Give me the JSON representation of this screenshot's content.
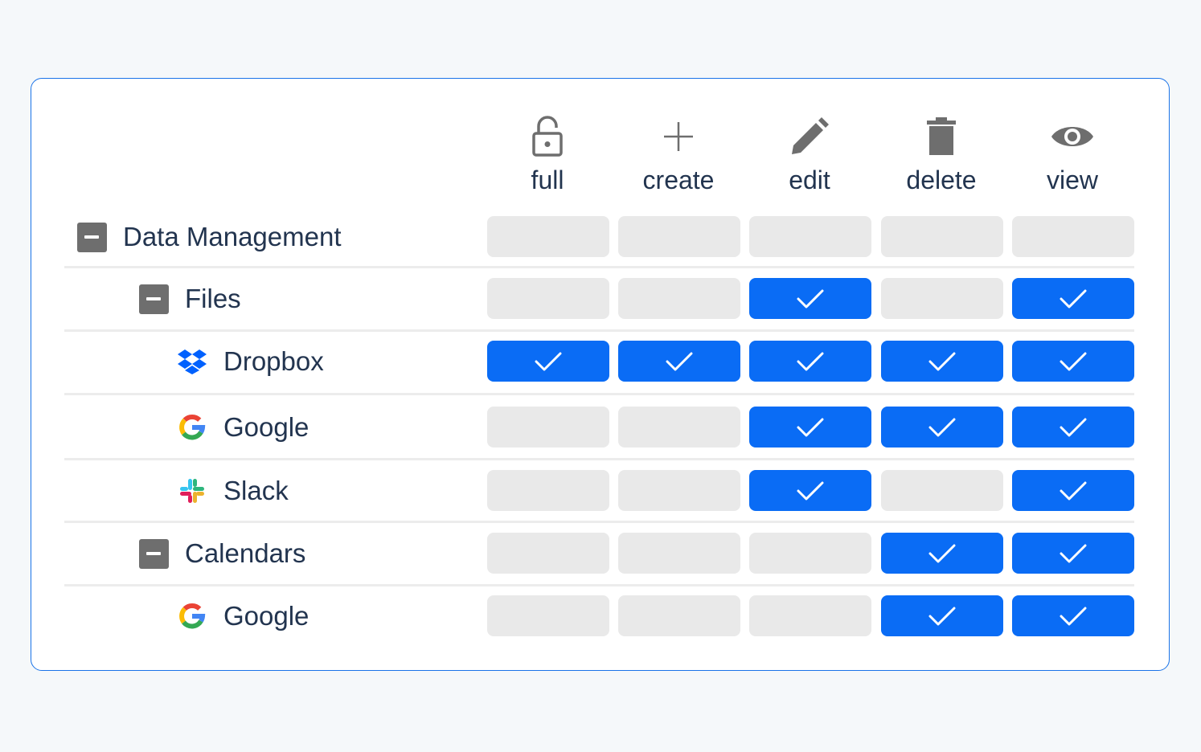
{
  "colors": {
    "accent": "#0a6cf5",
    "off": "#e9e9e9",
    "border": "#1a73e8",
    "text": "#22344f",
    "toggle": "#6e6e6e"
  },
  "columns": [
    {
      "label": "full",
      "icon": "unlock-icon"
    },
    {
      "label": "create",
      "icon": "plus-icon"
    },
    {
      "label": "edit",
      "icon": "pencil-icon"
    },
    {
      "label": "delete",
      "icon": "trash-icon"
    },
    {
      "label": "view",
      "icon": "eye-icon"
    }
  ],
  "rows": [
    {
      "label": "Data Management",
      "icon": "collapse-icon",
      "level": 0,
      "perms": [
        false,
        false,
        false,
        false,
        false
      ]
    },
    {
      "label": "Files",
      "icon": "collapse-icon",
      "level": 1,
      "perms": [
        false,
        false,
        true,
        false,
        true
      ]
    },
    {
      "label": "Dropbox",
      "icon": "dropbox-icon",
      "level": 2,
      "perms": [
        true,
        true,
        true,
        true,
        true
      ]
    },
    {
      "label": "Google",
      "icon": "google-icon",
      "level": 2,
      "perms": [
        false,
        false,
        true,
        true,
        true
      ]
    },
    {
      "label": "Slack",
      "icon": "slack-icon",
      "level": 2,
      "perms": [
        false,
        false,
        true,
        false,
        true
      ]
    },
    {
      "label": "Calendars",
      "icon": "collapse-icon",
      "level": 1,
      "perms": [
        false,
        false,
        false,
        true,
        true
      ]
    },
    {
      "label": "Google",
      "icon": "google-icon",
      "level": 2,
      "perms": [
        false,
        false,
        false,
        true,
        true
      ]
    }
  ]
}
